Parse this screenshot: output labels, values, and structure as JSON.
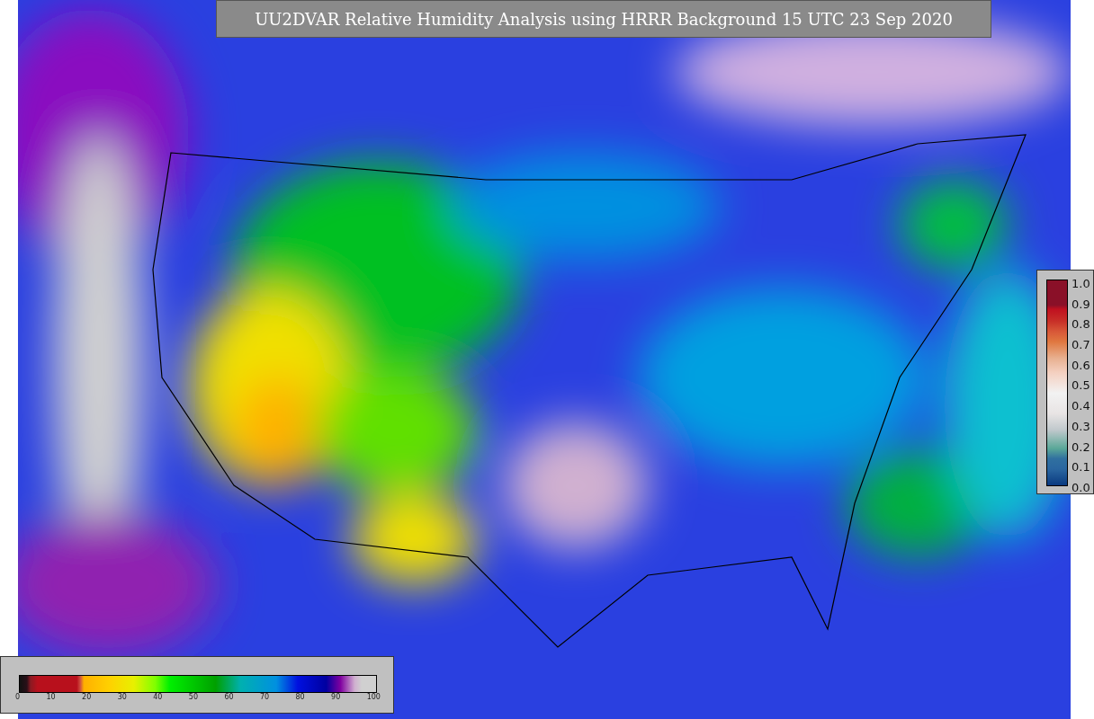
{
  "title": "UU2DVAR Relative Humidity Analysis using HRRR Background 15 UTC 23 Sep 2020",
  "humidity_colorbar": {
    "tick_labels": [
      "0",
      "10",
      "20",
      "30",
      "40",
      "50",
      "60",
      "70",
      "80",
      "90",
      "100"
    ]
  },
  "fraction_colorbar": {
    "tick_labels": [
      "1.0",
      "0.9",
      "0.8",
      "0.7",
      "0.6",
      "0.5",
      "0.4",
      "0.3",
      "0.2",
      "0.1",
      "0.0"
    ]
  }
}
